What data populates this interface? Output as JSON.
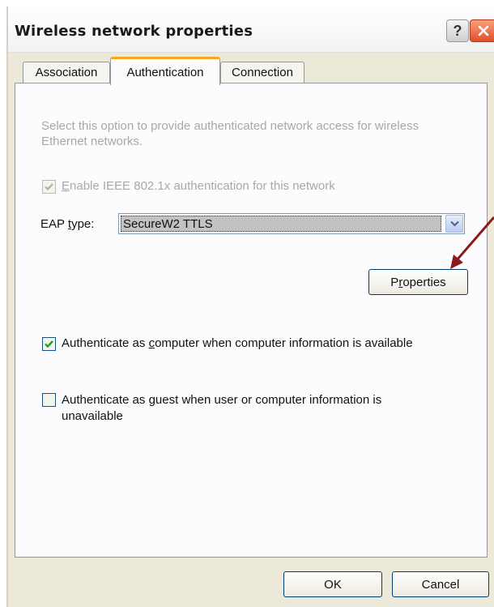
{
  "window": {
    "title": "Wireless network properties",
    "help_glyph": "?",
    "close_glyph": "X"
  },
  "tabs": [
    {
      "label": "Association",
      "active": false
    },
    {
      "label": "Authentication",
      "active": true
    },
    {
      "label": "Connection",
      "active": false
    }
  ],
  "authentication": {
    "description": "Select this option to provide authenticated network access for wireless Ethernet networks.",
    "enable_8021x": {
      "label_accel": "E",
      "label_rest": "nable IEEE 802.1x authentication for this network",
      "checked": true,
      "disabled": true
    },
    "eap_type": {
      "label_pre": "EAP ",
      "label_accel": "t",
      "label_post": "ype:",
      "value": "SecureW2 TTLS"
    },
    "properties_button": {
      "label_pre": "P",
      "label_accel": "r",
      "label_post": "operties"
    },
    "auth_as_computer": {
      "label_pre": "Authenticate as ",
      "label_accel": "c",
      "label_post": "omputer when computer information is available",
      "checked": true
    },
    "auth_as_guest": {
      "label_pre": "Authenticate as ",
      "label_accel": "g",
      "label_post": "uest when user or computer information is",
      "label_line2": "unavailable",
      "checked": false
    }
  },
  "footer": {
    "ok_label": "OK",
    "cancel_label": "Cancel"
  },
  "colors": {
    "annotation_arrow": "#8b1a1a",
    "active_tab_accent": "#f6a623",
    "dialog_background": "#ece9d8"
  }
}
